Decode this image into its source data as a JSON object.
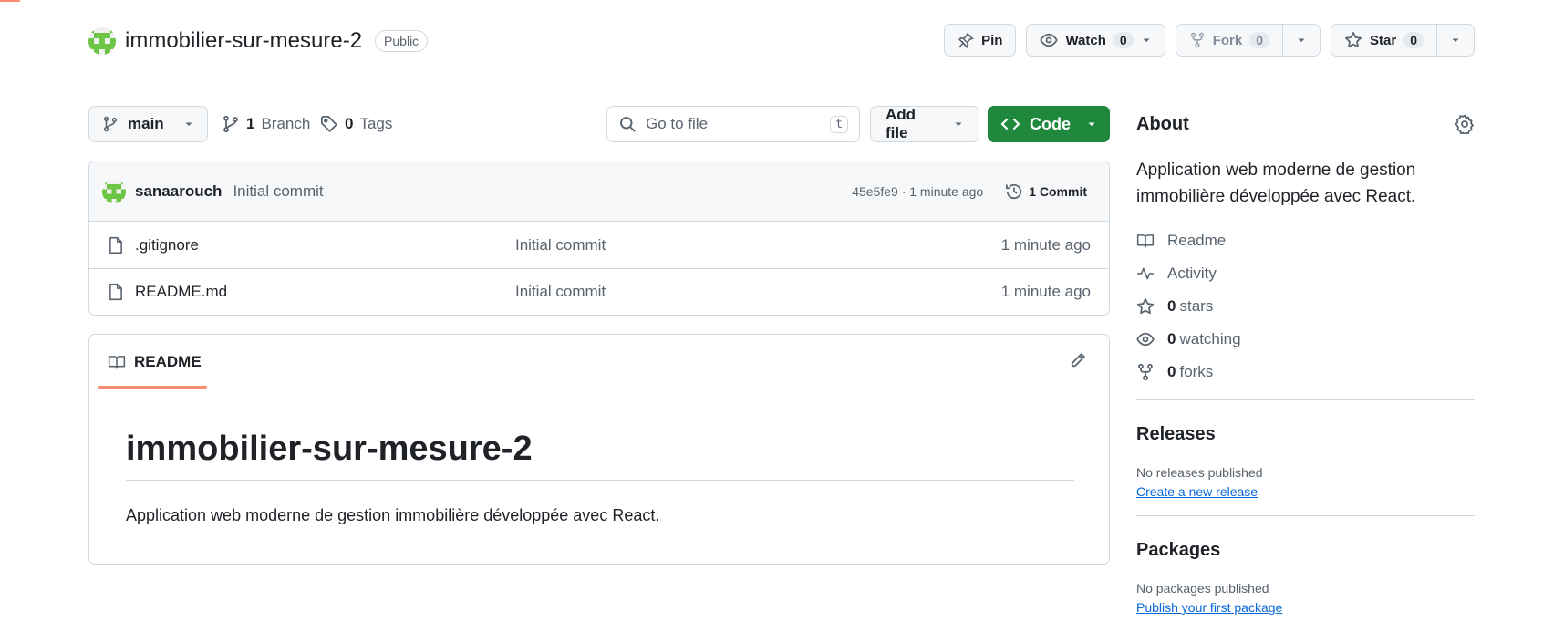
{
  "repo": {
    "name": "immobilier-sur-mesure-2",
    "visibility": "Public"
  },
  "actions": {
    "pin_label": "Pin",
    "watch_label": "Watch",
    "watch_count": "0",
    "fork_label": "Fork",
    "fork_count": "0",
    "star_label": "Star",
    "star_count": "0"
  },
  "nav": {
    "branch": "main",
    "branch_count": "1",
    "branch_label": "Branch",
    "tag_count": "0",
    "tag_label": "Tags",
    "search_placeholder": "Go to file",
    "search_shortcut": "t",
    "add_file_label": "Add file",
    "code_label": "Code"
  },
  "commit": {
    "author": "sanaarouch",
    "message": "Initial commit",
    "hash_time": "45e5fe9 · 1 minute ago",
    "count_label": "1 Commit"
  },
  "files": [
    {
      "name": ".gitignore",
      "commit": "Initial commit",
      "time": "1 minute ago"
    },
    {
      "name": "README.md",
      "commit": "Initial commit",
      "time": "1 minute ago"
    }
  ],
  "readme": {
    "tab_label": "README",
    "heading": "immobilier-sur-mesure-2",
    "body": "Application web moderne de gestion immobilière développée avec React."
  },
  "about": {
    "title": "About",
    "description": "Application web moderne de gestion immobilière développée avec React.",
    "readme_label": "Readme",
    "activity_label": "Activity",
    "stars_count": "0",
    "stars_label": "stars",
    "watching_count": "0",
    "watching_label": "watching",
    "forks_count": "0",
    "forks_label": "forks"
  },
  "releases": {
    "title": "Releases",
    "empty": "No releases published",
    "link": "Create a new release"
  },
  "packages": {
    "title": "Packages",
    "empty": "No packages published",
    "link": "Publish your first package"
  },
  "colors": {
    "accent": "#fd8c73",
    "code_button": "#1f883d",
    "link": "#0969da",
    "border": "#d1d9e0"
  }
}
